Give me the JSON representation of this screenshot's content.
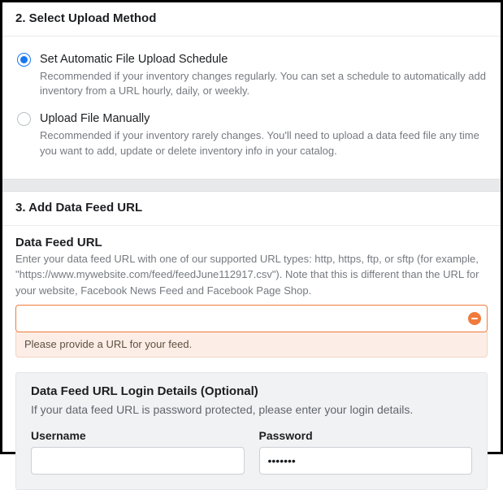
{
  "section2": {
    "heading": "2. Select Upload Method",
    "option_auto": {
      "title": "Set Automatic File Upload Schedule",
      "desc": "Recommended if your inventory changes regularly. You can set a schedule to automatically add inventory from a URL hourly, daily, or weekly."
    },
    "option_manual": {
      "title": "Upload File Manually",
      "desc": "Recommended if your inventory rarely changes. You'll need to upload a data feed file any time you want to add, update or delete inventory info in your catalog."
    }
  },
  "section3": {
    "heading": "3. Add Data Feed URL",
    "feed_label": "Data Feed URL",
    "feed_help": "Enter your data feed URL with one of our supported URL types: http, https, ftp, or sftp (for example, \"https://www.mywebsite.com/feed/feedJune112917.csv\"). Note that this is different than the URL for your website, Facebook News Feed and Facebook Page Shop.",
    "feed_value": "",
    "feed_error": "Please provide a URL for your feed.",
    "login": {
      "title": "Data Feed URL Login Details (Optional)",
      "desc": "If your data feed URL is password protected, please enter your login details.",
      "username_label": "Username",
      "username_value": "",
      "password_label": "Password",
      "password_value": "•••••••"
    }
  }
}
